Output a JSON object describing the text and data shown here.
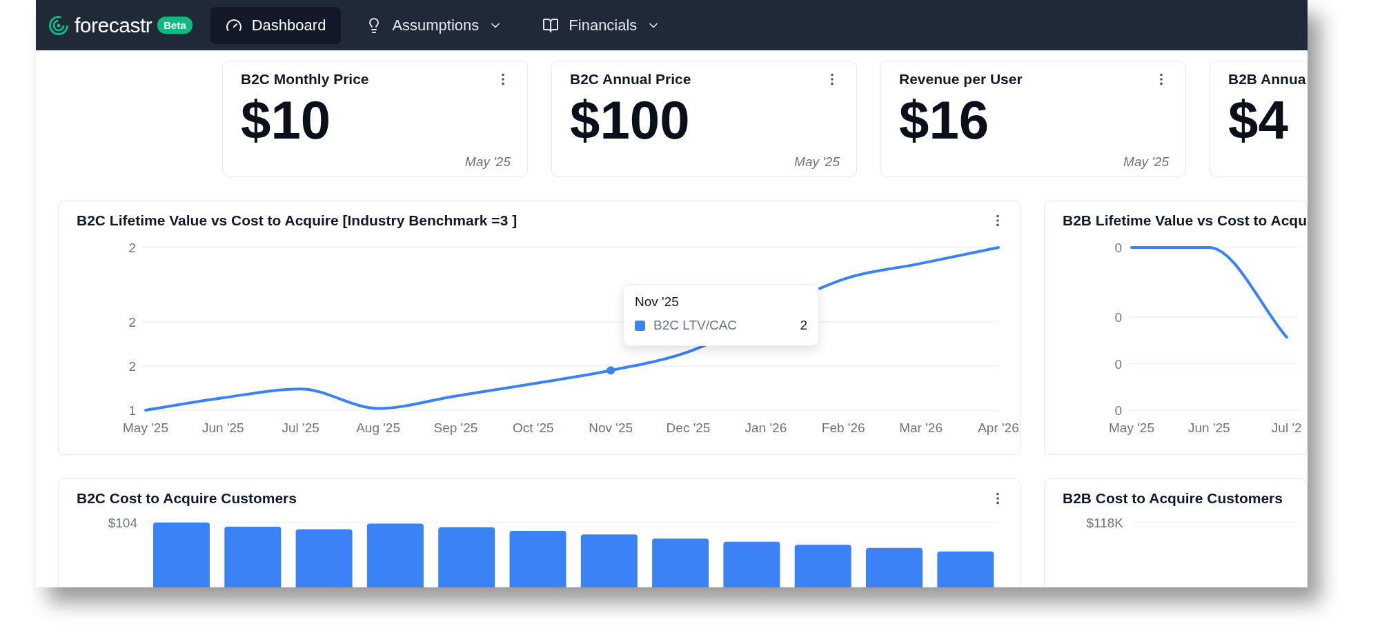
{
  "nav": {
    "brand": "forecastr",
    "badge": "Beta",
    "items": [
      {
        "label": "Dashboard",
        "selected": true,
        "dropdown": false
      },
      {
        "label": "Assumptions",
        "selected": false,
        "dropdown": true
      },
      {
        "label": "Financials",
        "selected": false,
        "dropdown": true
      }
    ]
  },
  "metric_cards": [
    {
      "title": "B2C Monthly Price",
      "value": "$10",
      "date": "May '25",
      "menu": true
    },
    {
      "title": "B2C Annual Price",
      "value": "$100",
      "date": "May '25",
      "menu": true
    },
    {
      "title": "Revenue per User",
      "value": "$16",
      "date": "May '25",
      "menu": true
    },
    {
      "title": "B2B Annua",
      "value": "$4",
      "menu": false
    }
  ],
  "chart_panels": [
    {
      "kind": "line",
      "title": "B2C Lifetime Value vs Cost to Acquire [Industry Benchmark =3 ]",
      "menu": true,
      "chart_data": {
        "type": "line",
        "grid": true,
        "categories": [
          "May '25",
          "Jun '25",
          "Jul '25",
          "Aug '25",
          "Sep '25",
          "Oct '25",
          "Nov '25",
          "Dec '25",
          "Jan '26",
          "Feb '26",
          "Mar '26",
          "Apr '26"
        ],
        "series": [
          {
            "name": "B2C LTV/CAC",
            "color": "#3b82f6",
            "values": [
              1.25,
              1.32,
              1.37,
              1.26,
              1.33,
              1.4,
              1.475,
              1.58,
              null,
              1.99,
              2.08,
              2.17
            ]
          }
        ],
        "ylim": [
          1.25,
          2.17
        ],
        "yticks": [
          {
            "value": 1.25,
            "label": "1"
          },
          {
            "value": 1.5,
            "label": "2"
          },
          {
            "value": 1.75,
            "label": "2"
          },
          {
            "value": 2.17,
            "label": "2"
          }
        ]
      },
      "tooltip": {
        "title": "Nov '25",
        "value": "2"
      }
    },
    {
      "kind": "line",
      "title": "B2B Lifetime Value vs Cost to Acqu",
      "menu": false,
      "chart_data": {
        "type": "line",
        "grid": true,
        "categories": [
          "May '25",
          "Jun '25",
          "Jul '2"
        ],
        "series": [
          {
            "color": "#3b82f6",
            "values": [
              0.45,
              0.45,
              0.257
            ]
          }
        ],
        "ylim": [
          0.1,
          0.45
        ],
        "yticks": [
          {
            "value": 0.1,
            "label": "0"
          },
          {
            "value": 0.2,
            "label": "0"
          },
          {
            "value": 0.3,
            "label": "0"
          },
          {
            "value": 0.45,
            "label": "0"
          }
        ]
      }
    },
    {
      "kind": "bars",
      "title": "B2C Cost to Acquire Customers",
      "menu": true,
      "top_tick": "$104"
    },
    {
      "kind": "bars",
      "title": "B2B Cost to Acquire Customers",
      "menu": false,
      "top_tick": "$118K"
    }
  ]
}
